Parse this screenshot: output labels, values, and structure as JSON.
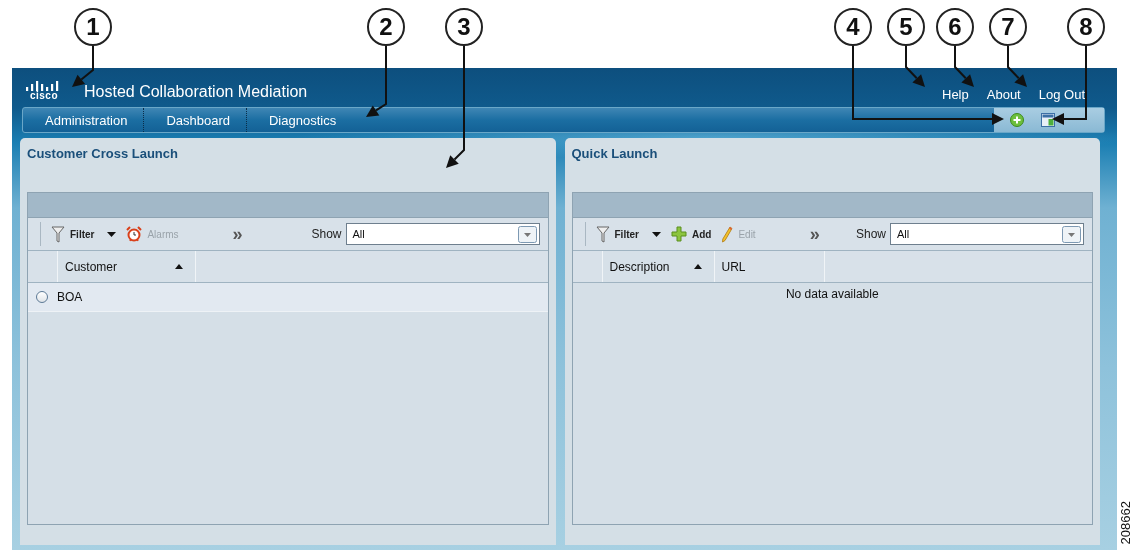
{
  "callouts": [
    "1",
    "2",
    "3",
    "4",
    "5",
    "6",
    "7",
    "8"
  ],
  "header": {
    "logo": "cisco",
    "title": "Hosted Collaboration Mediation",
    "links": [
      "Help",
      "About",
      "Log Out"
    ]
  },
  "nav": {
    "tabs": [
      "Administration",
      "Dashboard",
      "Diagnostics"
    ],
    "tools": [
      {
        "kind": "add"
      },
      {
        "kind": "layout"
      }
    ]
  },
  "panels": [
    {
      "title": "Customer Cross Launch",
      "toolbar": [
        {
          "kind": "filter",
          "label": "Filter",
          "disabled": false
        },
        {
          "kind": "alarms",
          "label": "Alarms",
          "disabled": true
        },
        {
          "kind": "more",
          "label": "»",
          "disabled": false
        }
      ],
      "show": {
        "label": "Show",
        "value": "All"
      },
      "columns": [
        {
          "label": "Customer",
          "sorted": true
        }
      ],
      "rows": [
        {
          "cells": [
            "BOA"
          ],
          "selected": false
        }
      ]
    },
    {
      "title": "Quick Launch",
      "toolbar": [
        {
          "kind": "filter",
          "label": "Filter",
          "disabled": false
        },
        {
          "kind": "add",
          "label": "Add",
          "disabled": false
        },
        {
          "kind": "edit",
          "label": "Edit",
          "disabled": true
        },
        {
          "kind": "more",
          "label": "»",
          "disabled": false
        }
      ],
      "show": {
        "label": "Show",
        "value": "All"
      },
      "columns": [
        {
          "label": "Description",
          "sorted": true
        },
        {
          "label": "URL",
          "sorted": false
        }
      ],
      "empty_text": "No data available"
    }
  ],
  "figure_number": "208662"
}
